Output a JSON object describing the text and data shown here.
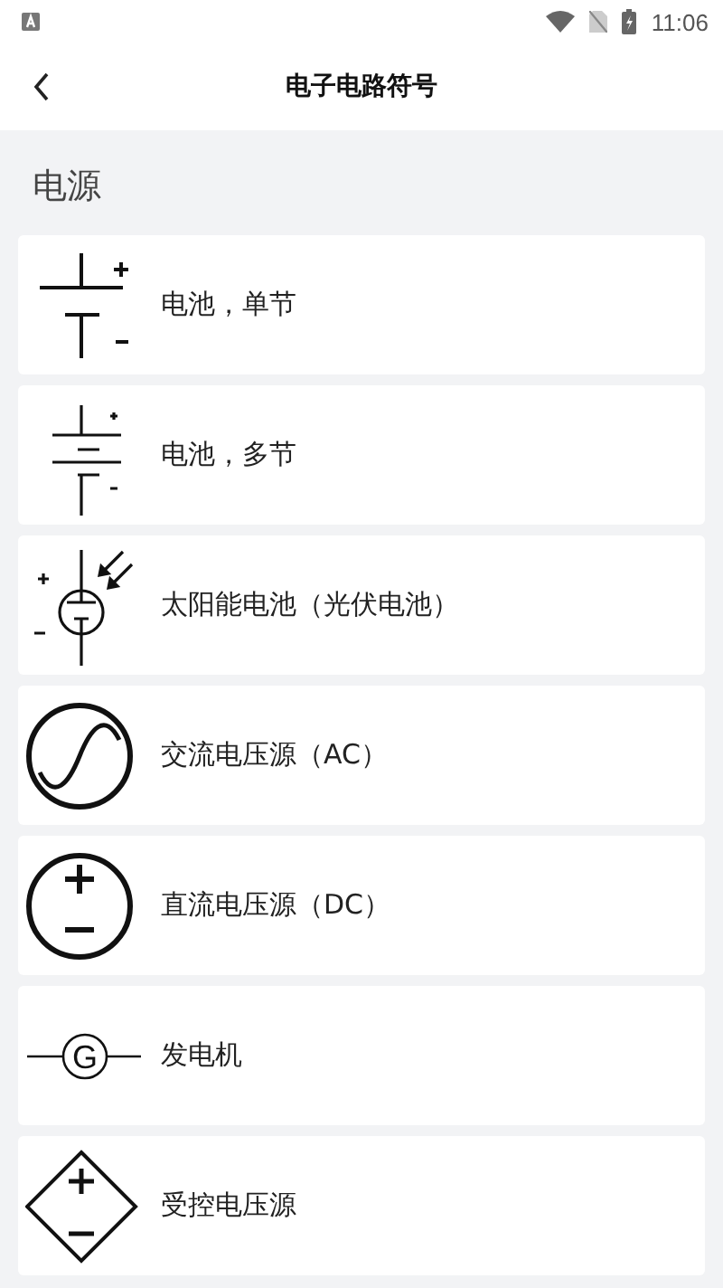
{
  "status_bar": {
    "time": "11:06"
  },
  "header": {
    "title": "电子电路符号"
  },
  "section": {
    "title": "电源"
  },
  "items": [
    {
      "kind": "battery-single",
      "label": "电池，单节"
    },
    {
      "kind": "battery-multi",
      "label": "电池，多节"
    },
    {
      "kind": "solar",
      "label": "太阳能电池（光伏电池）"
    },
    {
      "kind": "ac",
      "label": "交流电压源（AC）"
    },
    {
      "kind": "dc",
      "label": "直流电压源（DC）"
    },
    {
      "kind": "generator",
      "label": "发电机",
      "symbol_letter": "G"
    },
    {
      "kind": "controlled",
      "label": "受控电压源"
    }
  ]
}
